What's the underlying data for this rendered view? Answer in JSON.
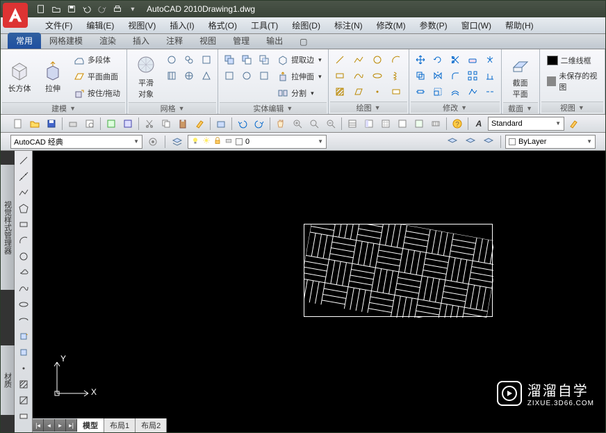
{
  "title": {
    "app": "AutoCAD 2010",
    "file": "Drawing1.dwg"
  },
  "menus": [
    "文件(F)",
    "编辑(E)",
    "视图(V)",
    "插入(I)",
    "格式(O)",
    "工具(T)",
    "绘图(D)",
    "标注(N)",
    "修改(M)",
    "参数(P)",
    "窗口(W)",
    "帮助(H)"
  ],
  "tabs": [
    "常用",
    "网格建模",
    "渲染",
    "插入",
    "注释",
    "视图",
    "管理",
    "输出"
  ],
  "panels": {
    "modeling": {
      "title": "建模",
      "box": "长方体",
      "extrude": "拉伸",
      "polysolid": "多段体",
      "planesurf": "平面曲面",
      "presspull": "按住/拖动"
    },
    "mesh": {
      "title": "网格",
      "smooth": "平滑\n对象"
    },
    "solid": {
      "title": "实体编辑",
      "extract_edges": "提取边",
      "extrude_face": "拉伸面",
      "separate": "分割"
    },
    "draw": {
      "title": "绘图"
    },
    "modify": {
      "title": "修改"
    },
    "section": {
      "title": "截面",
      "sectionplane": "截面\n平面"
    },
    "view": {
      "title": "视图",
      "wireframe2d": "二维线框",
      "unsaved": "未保存的视图"
    }
  },
  "workspace_select": "AutoCAD 经典",
  "layer_display": "0",
  "style_select": "Standard",
  "color_select": "ByLayer",
  "side_tabs": {
    "visual": "视觉样式管理器",
    "material": "材质"
  },
  "ucs": {
    "x": "X",
    "y": "Y"
  },
  "layout_tabs": [
    "模型",
    "布局1",
    "布局2"
  ],
  "watermark": {
    "main": "溜溜自学",
    "sub": "ZIXUE.3D66.COM"
  }
}
